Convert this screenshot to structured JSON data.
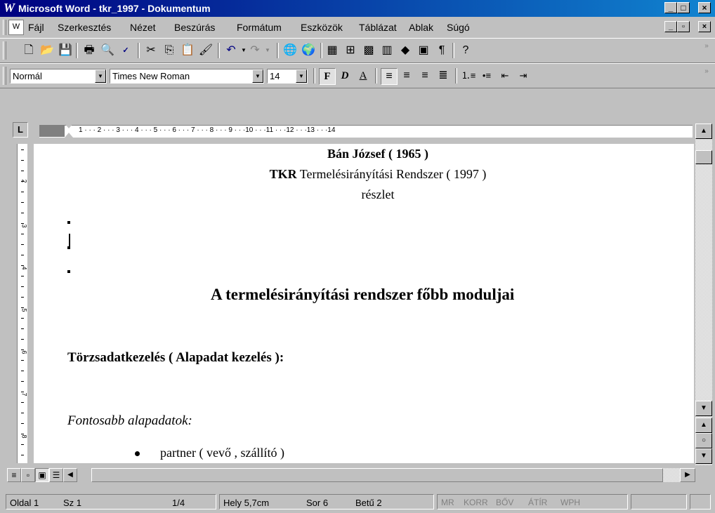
{
  "window": {
    "title": "Microsoft Word - tkr_1997 - Dokumentum",
    "minimize": "_",
    "maximize": "□",
    "close": "×"
  },
  "menu": {
    "items": [
      "Fájl",
      "Szerkesztés",
      "Nézet",
      "Beszúrás",
      "Formátum",
      "Eszközök",
      "Táblázat",
      "Ablak",
      "Súgó"
    ]
  },
  "format_toolbar": {
    "style_value": "Normál",
    "font_value": "Times New Roman",
    "size_value": "14",
    "bold_label": "F",
    "italic_label": "D",
    "underline_label": "A"
  },
  "ruler": {
    "numbers": "1 · · · 2 · · · 3 · · · 4 · · · 5 · · · 6 · · · 7 · · · 8 · · · 9 · · ·10 · · ·11 · · ·12 · · ·13 · · ·14"
  },
  "vruler": {
    "numbers": [
      "2",
      "3",
      "4",
      "5",
      "6",
      "7",
      "8"
    ]
  },
  "document": {
    "author_line": "Bán József ( 1965 )",
    "subtitle_bold": "TKR",
    "subtitle_rest": " Termelésirányítási Rendszer ( 1997 )",
    "excerpt": "részlet",
    "heading": "A termelésirányítási rendszer főbb moduljai",
    "section_heading": "Törzsadatkezelés ( Alapadat kezelés ):",
    "italic_label": "Fontosabb alapadatok:",
    "bullet_items": [
      "partner ( vevő , szállító )"
    ]
  },
  "status": {
    "page": "Oldal 1",
    "section": "Sz 1",
    "page_of": "1/4",
    "position": "Hely 5,7cm",
    "line": "Sor 6",
    "column": "Betű 2",
    "indicators": [
      "MR",
      "KORR",
      "BŐV",
      "ÁTÍR",
      "WPH"
    ]
  }
}
